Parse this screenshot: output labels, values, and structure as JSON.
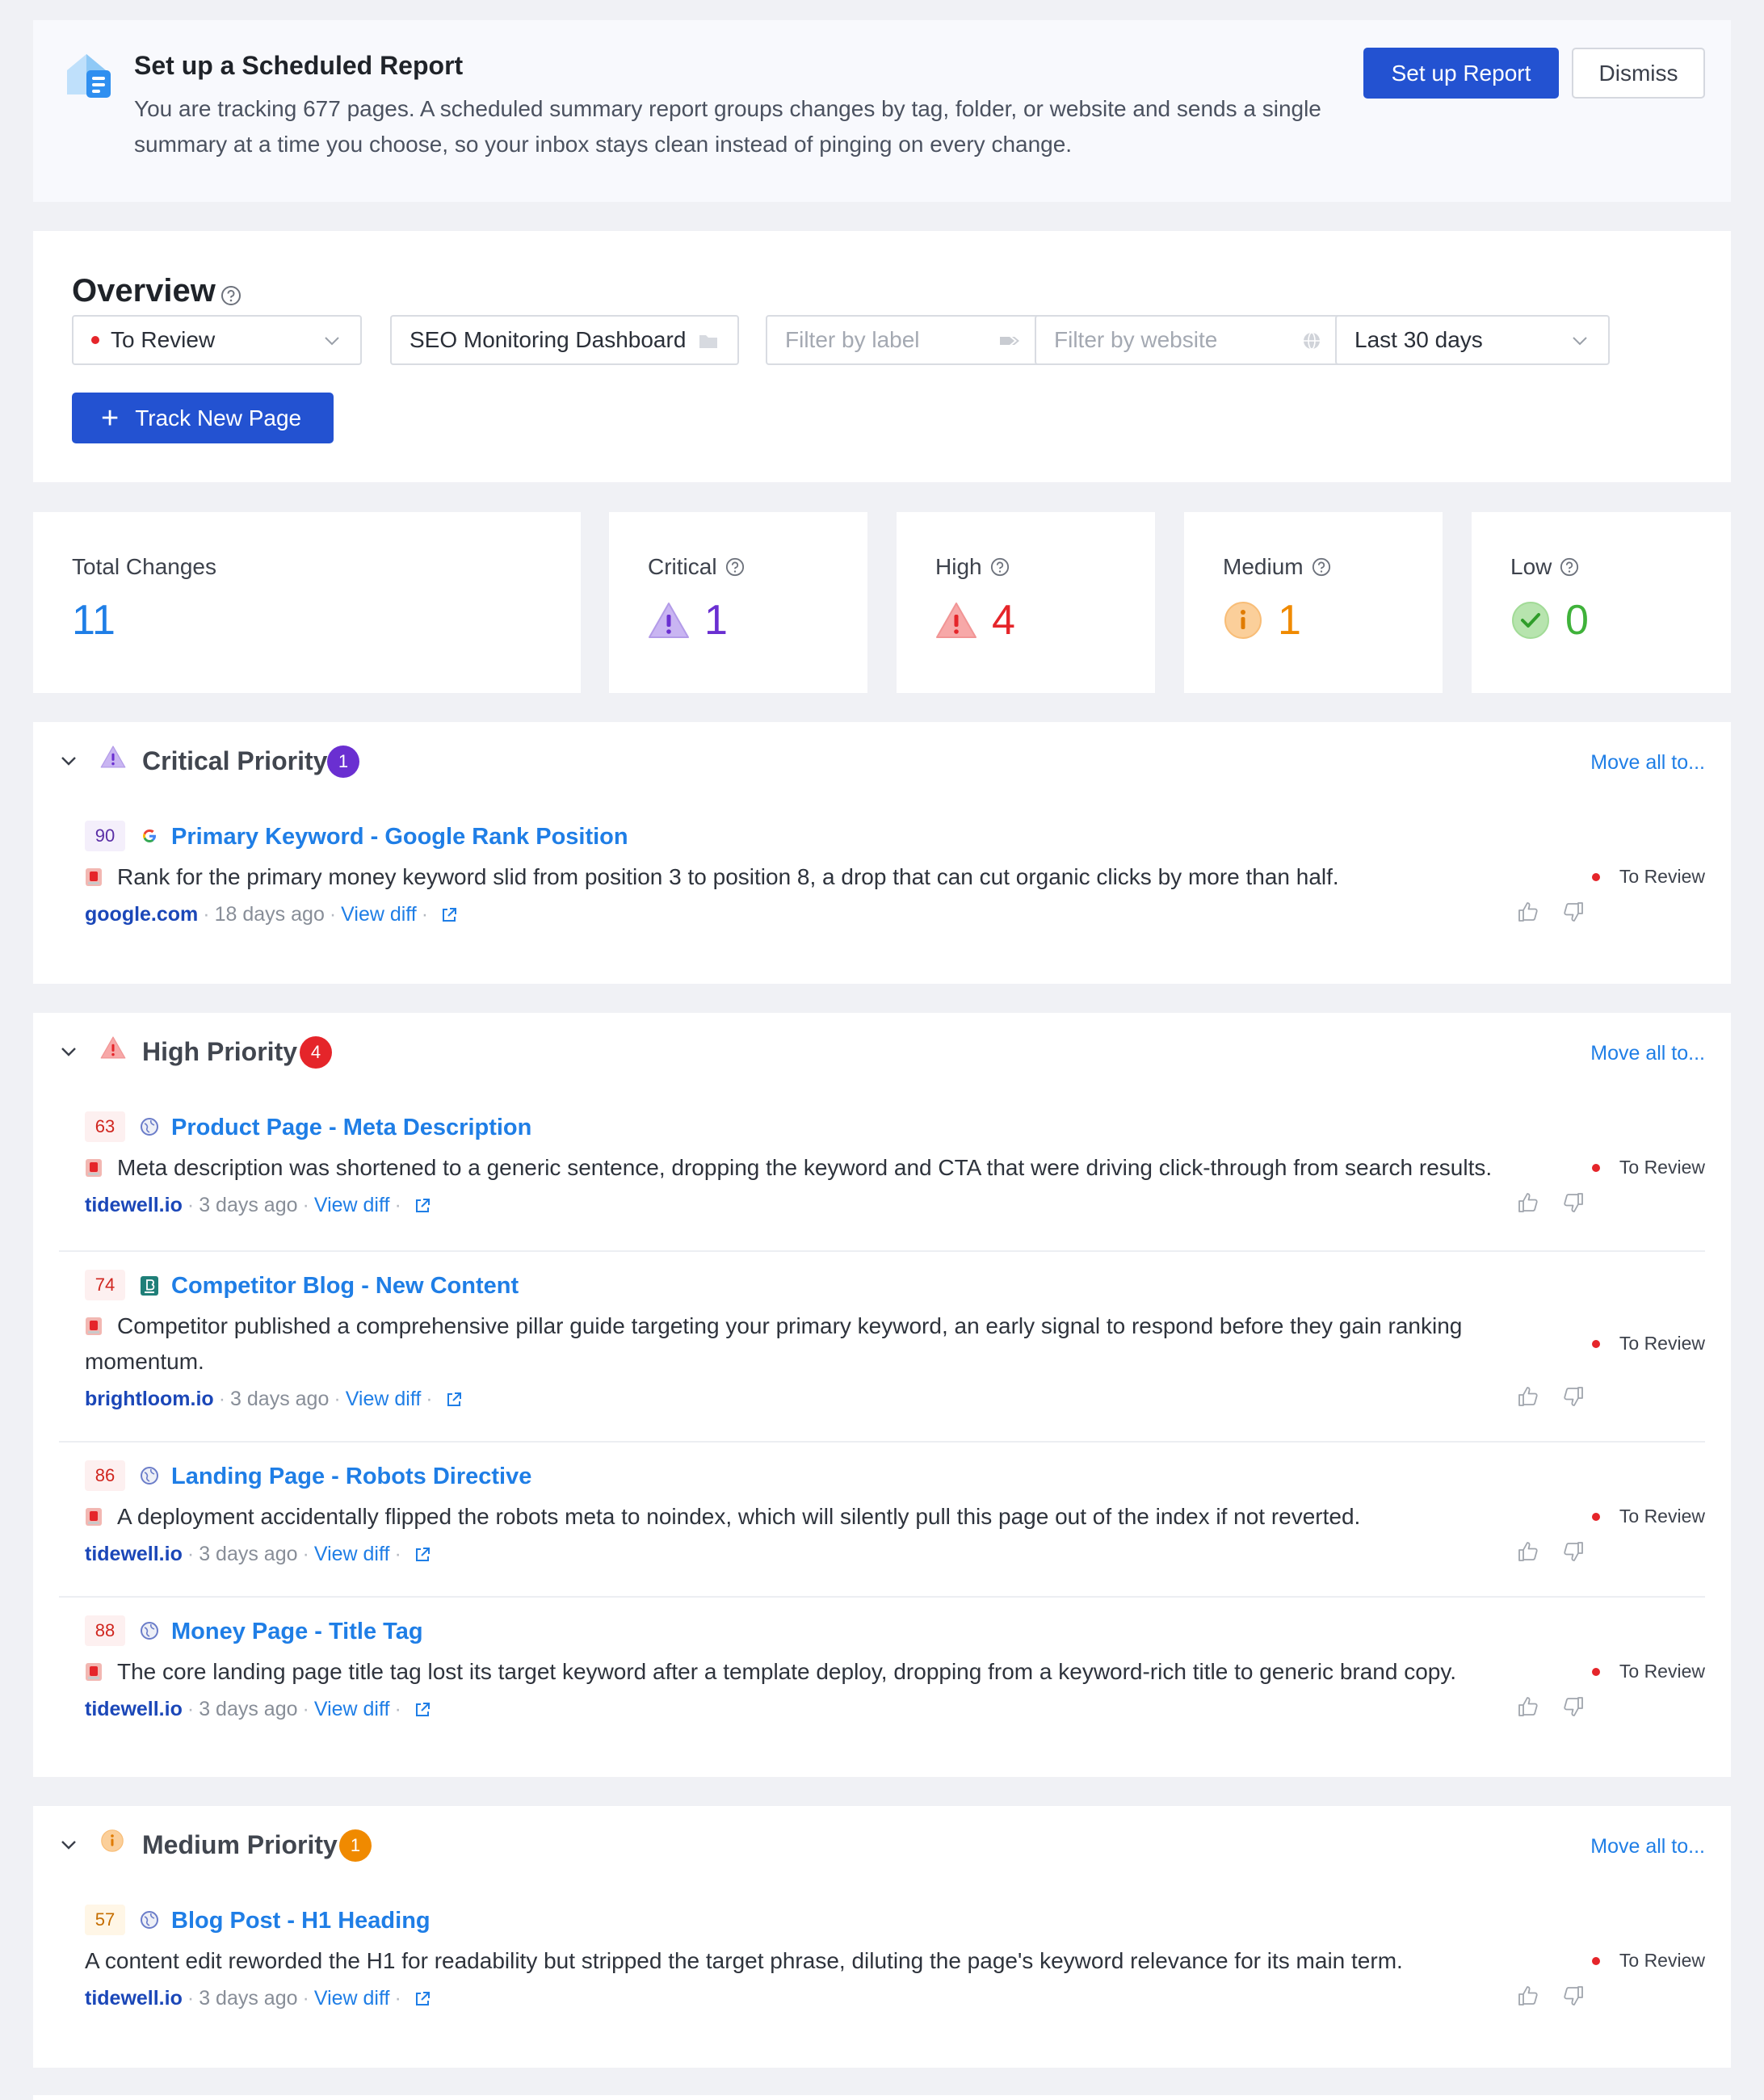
{
  "banner": {
    "title": "Set up a Scheduled Report",
    "text": "You are tracking 677 pages. A scheduled summary report groups changes by tag, folder, or website and sends a single summary at a time you choose, so your inbox stays clean instead of pinging on every change.",
    "setup_label": "Set up Report",
    "dismiss_label": "Dismiss"
  },
  "overview": {
    "title": "Overview",
    "filters": {
      "status": "To Review",
      "folder": "SEO Monitoring Dashboard",
      "label_placeholder": "Filter by label",
      "website_placeholder": "Filter by website",
      "range": "Last 30 days"
    },
    "track_label": "Track New Page"
  },
  "stats": {
    "total": {
      "label": "Total Changes",
      "value": "11",
      "color": "#1f7ee6"
    },
    "critical": {
      "label": "Critical",
      "value": "1",
      "color": "#6a2fd1"
    },
    "high": {
      "label": "High",
      "value": "4",
      "color": "#e5252a"
    },
    "medium": {
      "label": "Medium",
      "value": "1",
      "color": "#f08a00"
    },
    "low": {
      "label": "Low",
      "value": "0",
      "color": "#3fb23a"
    }
  },
  "move_all_label": "Move all to...",
  "sections": {
    "critical": {
      "title": "Critical Priority",
      "count": "1",
      "badge_color": "#6a2fd1",
      "items": [
        {
          "score": "90",
          "title": "Primary Keyword - Google Rank Position",
          "desc": "Rank for the primary money keyword slid from position 3 to position 8, a drop that can cut organic clicks by more than half.",
          "site": "google.com",
          "time": "18 days ago",
          "diff": "View diff",
          "status": "To Review"
        }
      ]
    },
    "high": {
      "title": "High Priority",
      "count": "4",
      "badge_color": "#e5252a",
      "items": [
        {
          "score": "63",
          "title": "Product Page - Meta Description",
          "desc": "Meta description was shortened to a generic sentence, dropping the keyword and CTA that were driving click-through from search results.",
          "site": "tidewell.io",
          "time": "3 days ago",
          "diff": "View diff",
          "status": "To Review"
        },
        {
          "score": "74",
          "title": "Competitor Blog - New Content",
          "desc": "Competitor published a comprehensive pillar guide targeting your primary keyword, an early signal to respond before they gain ranking momentum.",
          "site": "brightloom.io",
          "time": "3 days ago",
          "diff": "View diff",
          "status": "To Review"
        },
        {
          "score": "86",
          "title": "Landing Page - Robots Directive",
          "desc": "A deployment accidentally flipped the robots meta to noindex, which will silently pull this page out of the index if not reverted.",
          "site": "tidewell.io",
          "time": "3 days ago",
          "diff": "View diff",
          "status": "To Review"
        },
        {
          "score": "88",
          "title": "Money Page - Title Tag",
          "desc": "The core landing page title tag lost its target keyword after a template deploy, dropping from a keyword-rich title to generic brand copy.",
          "site": "tidewell.io",
          "time": "3 days ago",
          "diff": "View diff",
          "status": "To Review"
        }
      ]
    },
    "medium": {
      "title": "Medium Priority",
      "count": "1",
      "badge_color": "#f08a00",
      "items": [
        {
          "score": "57",
          "title": "Blog Post - H1 Heading",
          "desc": "A content edit reworded the H1 for readability but stripped the target phrase, diluting the page's keyword relevance for its main term.",
          "site": "tidewell.io",
          "time": "3 days ago",
          "diff": "View diff",
          "status": "To Review"
        }
      ]
    }
  }
}
